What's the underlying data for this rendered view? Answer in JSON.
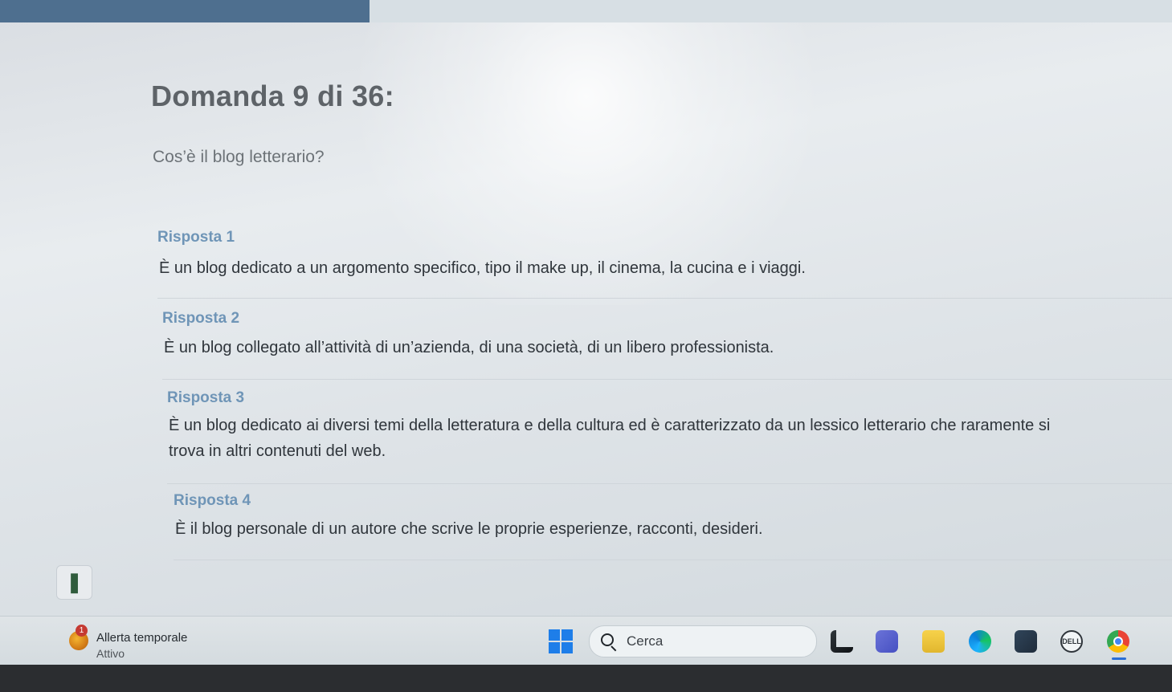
{
  "progress": {
    "fraction_complete": 0.315
  },
  "quiz": {
    "title": "Domanda 9 di 36:",
    "question": "Cos’è il blog letterario?",
    "answers": [
      {
        "label": "Risposta 1",
        "text": "È un blog dedicato a un argomento specifico, tipo il make up, il cinema, la cucina e i viaggi."
      },
      {
        "label": "Risposta 2",
        "text": "È un blog collegato all’attività di un’azienda, di una società, di un libero professionista."
      },
      {
        "label": "Risposta 3",
        "text": "È un blog dedicato ai diversi temi della letteratura e della cultura ed è caratterizzato da un lessico letterario che raramente si trova in altri contenuti del web."
      },
      {
        "label": "Risposta 4",
        "text": "È il blog personale di un autore che scrive le proprie esperienze, racconti, desideri."
      }
    ]
  },
  "taskbar": {
    "weather": {
      "badge": "1",
      "title": "Allerta temporale",
      "subtitle": "Attivo"
    },
    "search": {
      "placeholder": "Cerca"
    },
    "dell_label": "DELL"
  },
  "colors": {
    "progress_fill": "#4e6f8f",
    "answer_label": "#6f95b7",
    "title": "#5e6368",
    "windows_blue": "#1e7ee9"
  },
  "icons": [
    "info-icon",
    "weather-alert-icon",
    "windows-start-icon",
    "search-icon",
    "files-icon",
    "teams-icon",
    "file-explorer-icon",
    "edge-icon",
    "store-icon",
    "dell-icon",
    "chrome-icon"
  ]
}
